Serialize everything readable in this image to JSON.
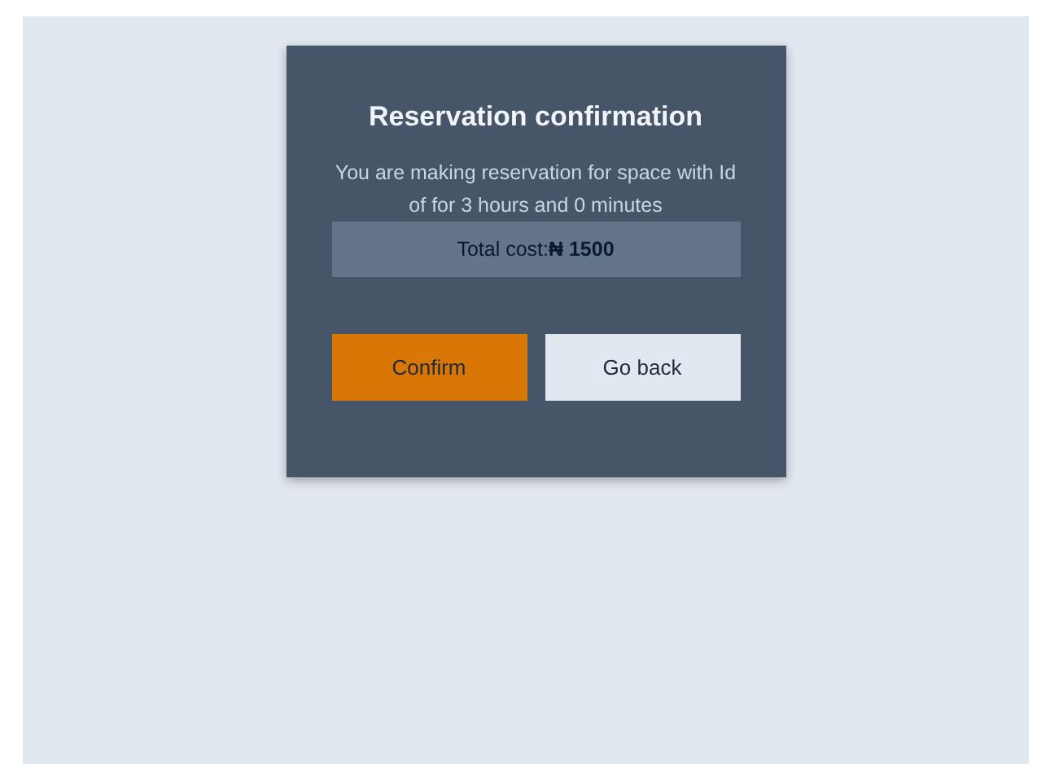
{
  "dialog": {
    "title": "Reservation confirmation",
    "message": "You are making reservation for space with Id of for 3 hours and 0 minutes",
    "total": "Total cost:**₦ 1500**",
    "buttons": [
      {
        "label": "Confirm",
        "kind": "primary"
      },
      {
        "label": "Go back",
        "kind": "secondary"
      }
    ]
  }
}
